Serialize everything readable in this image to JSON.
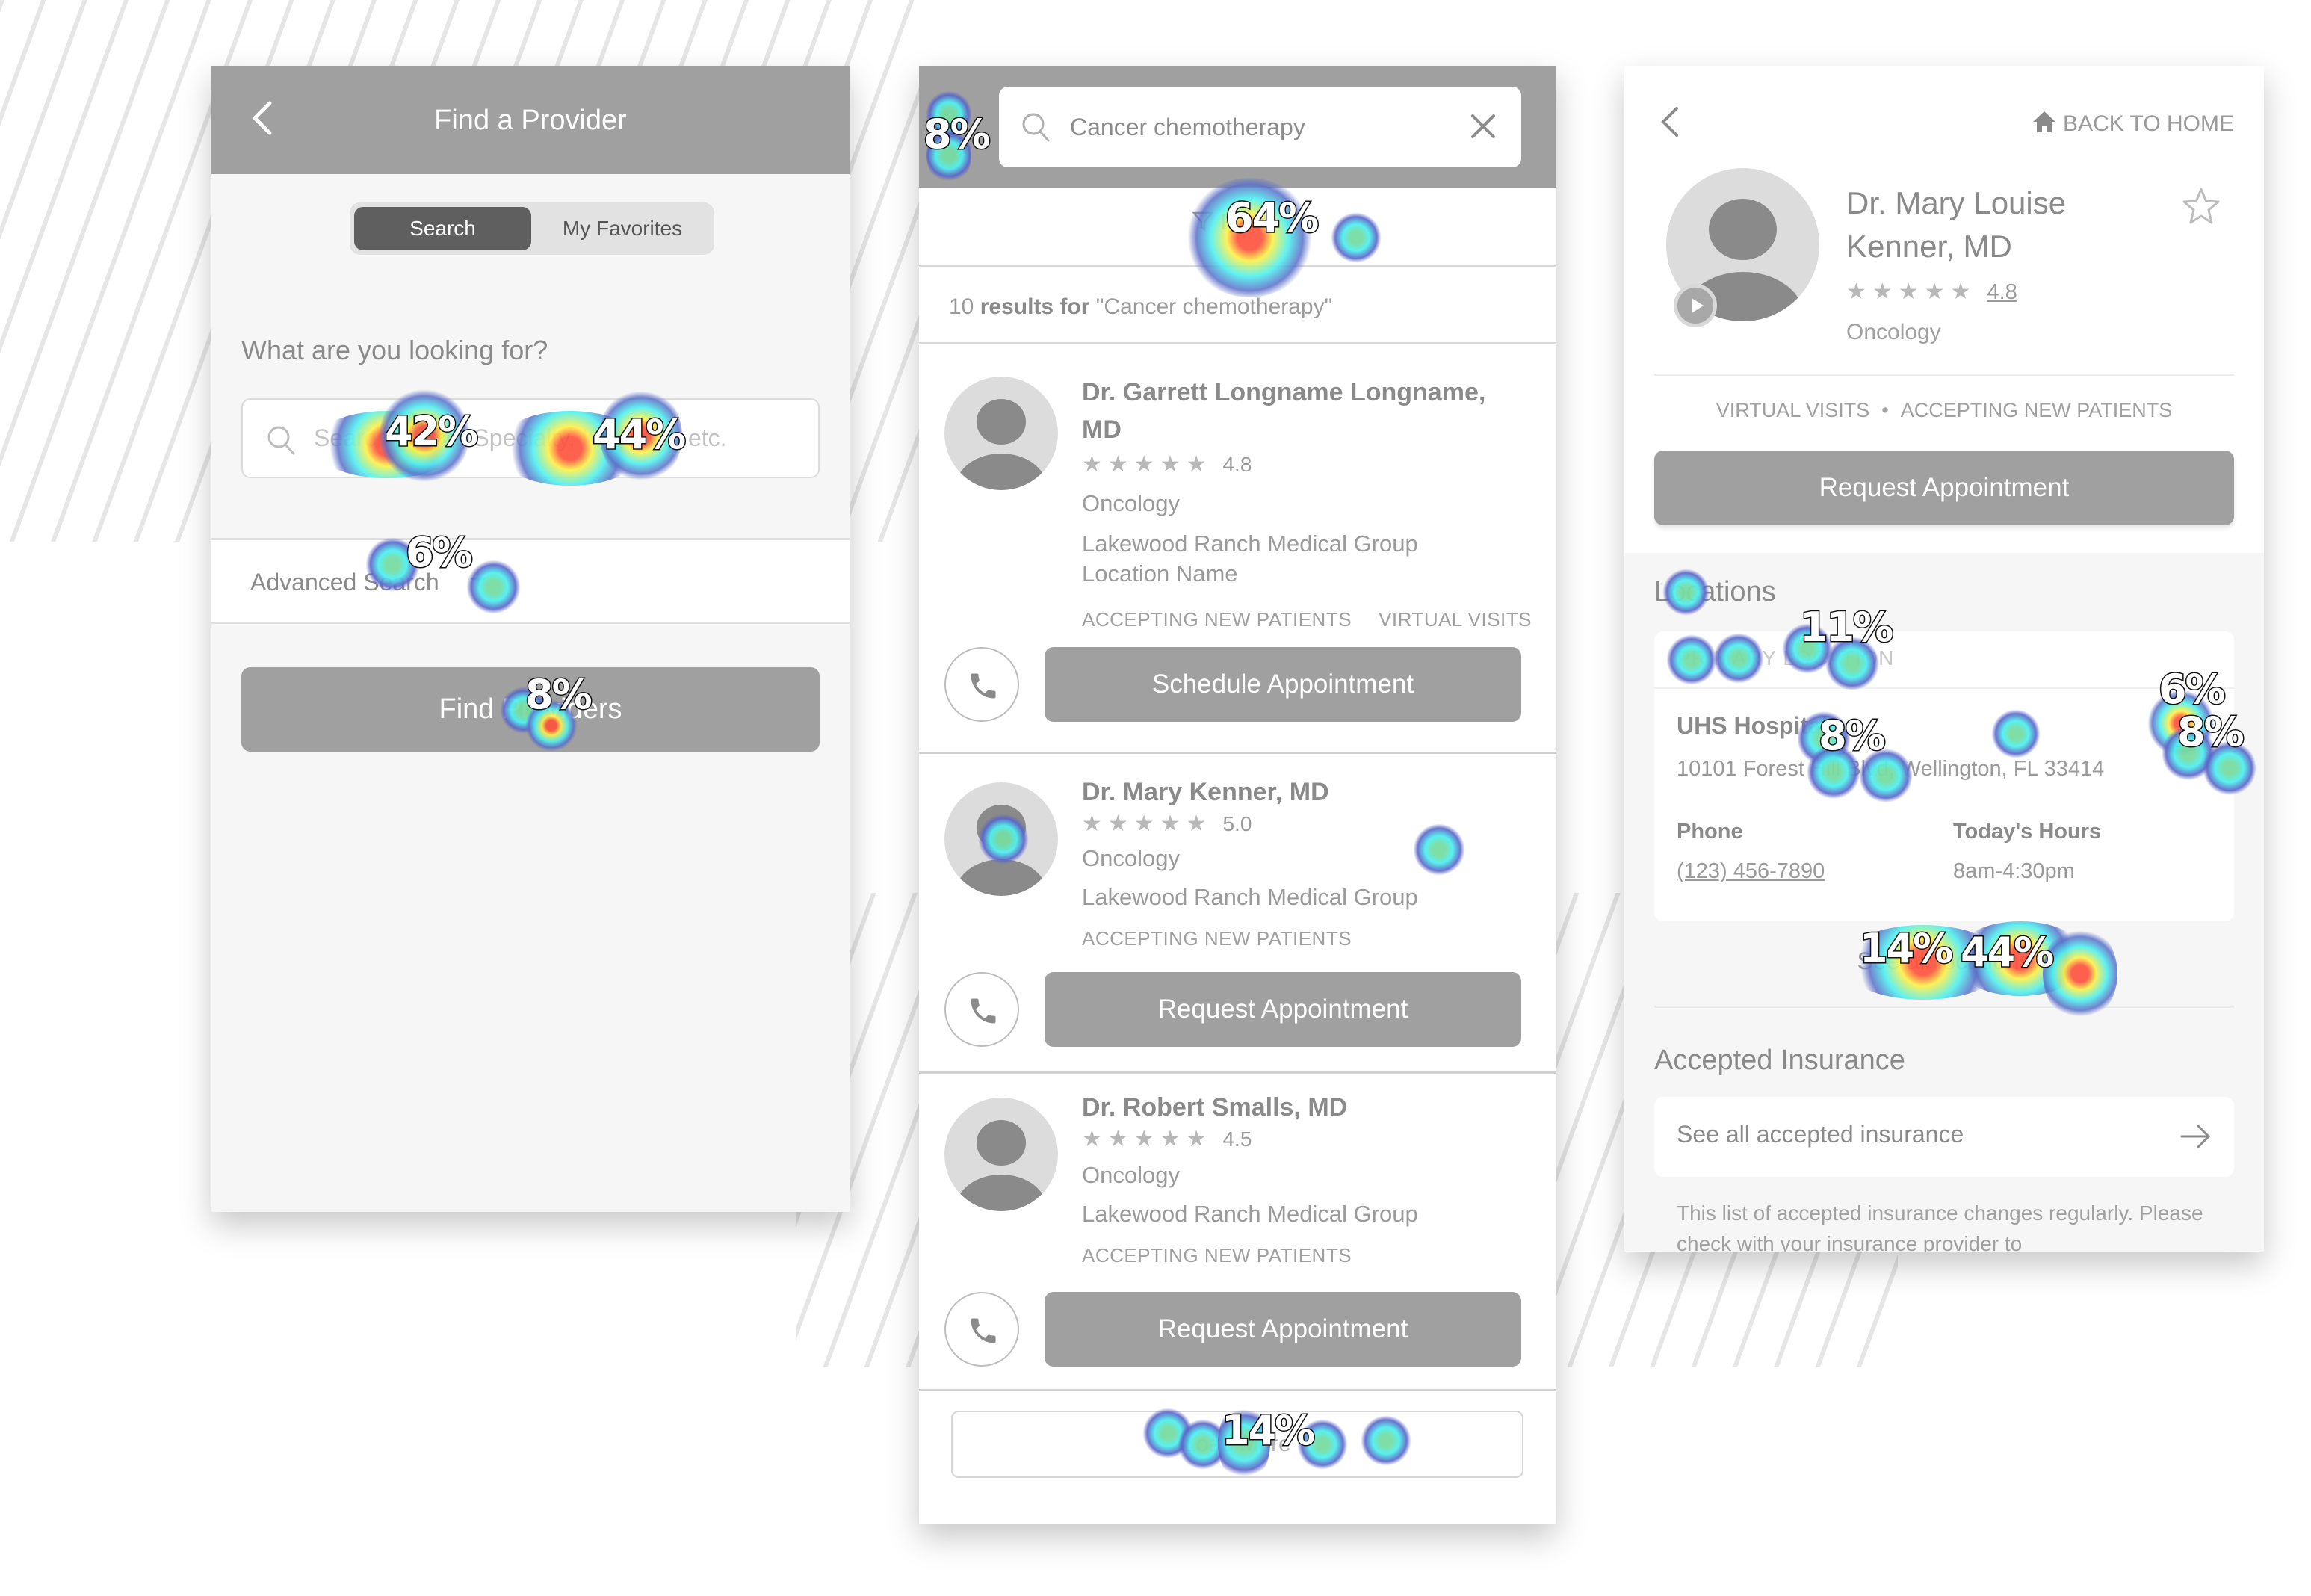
{
  "screen1": {
    "title": "Find a Provider",
    "tabs": [
      {
        "label": "Search",
        "selected": true
      },
      {
        "label": "My Favorites",
        "selected": false
      }
    ],
    "question": "What are you looking for?",
    "search_placeholder": "Search Name, Specialty, Keyword, etc.",
    "search_value": "",
    "advanced_search_label": "Advanced Search",
    "advanced_search_icon": "+",
    "find_button": "Find Providers",
    "heatmap": {
      "search_left": "42%",
      "search_right": "44%",
      "advanced": "6%",
      "find": "8%"
    }
  },
  "screen2": {
    "search_value": "Cancer chemotherapy",
    "filter_label": "Filter",
    "results_count": "10",
    "results_word": "results for",
    "results_query": "\"Cancer chemotherapy\"",
    "providers": [
      {
        "name": "Dr. Garrett Longname Longname, MD",
        "rating": "4.8",
        "specialty": "Oncology",
        "group": "Lakewood Ranch Medical Group",
        "location": "Location Name",
        "tags": [
          "ACCEPTING NEW PATIENTS",
          "VIRTUAL VISITS"
        ],
        "action": "Schedule Appointment"
      },
      {
        "name": "Dr. Mary Kenner, MD",
        "rating": "5.0",
        "specialty": "Oncology",
        "group": "Lakewood Ranch Medical Group",
        "tags": [
          "ACCEPTING NEW PATIENTS"
        ],
        "action": "Request Appointment"
      },
      {
        "name": "Dr. Robert Smalls, MD",
        "rating": "4.5",
        "specialty": "Oncology",
        "group": "Lakewood Ranch Medical Group",
        "tags": [
          "ACCEPTING NEW PATIENTS"
        ],
        "action": "Request Appointment"
      }
    ],
    "load_more": "Load More",
    "heatmap": {
      "back": "8%",
      "filter": "64%",
      "load_more": "14%"
    }
  },
  "screen3": {
    "back_home": "BACK TO HOME",
    "name": "Dr. Mary Louise Kenner, MD",
    "rating": "4.8",
    "specialty": "Oncology",
    "tags": [
      "VIRTUAL VISITS",
      "ACCEPTING NEW PATIENTS"
    ],
    "tag_separator": "•",
    "request_button": "Request Appointment",
    "locations_title": "Locations",
    "primary_location_label": "PRIMARY LOCATION",
    "location_name": "UHS Hospital",
    "location_address": "10101 Forest Hill Blvd, Wellington, FL 33414",
    "phone_label": "Phone",
    "phone_value": "(123) 456-7890",
    "hours_label": "Today's Hours",
    "hours_value": "8am-4:30pm",
    "see_all_locations": "See all locations",
    "insurance_title": "Accepted Insurance",
    "see_all_insurance": "See all accepted insurance",
    "insurance_note": "This list of accepted insurance changes regularly. Please check with your insurance provider to",
    "heatmap": {
      "primary": "11%",
      "hospital": "8%",
      "right_top": "6%",
      "right_bottom": "8%",
      "see_all_left": "14%",
      "see_all_right": "44%"
    }
  },
  "stars": "★★★★★",
  "colors": {
    "header_gray": "#a0a0a0",
    "segment_selected": "#5f5f5f",
    "text_gray": "#8a8a8a",
    "page_bg": "#f6f6f6"
  }
}
